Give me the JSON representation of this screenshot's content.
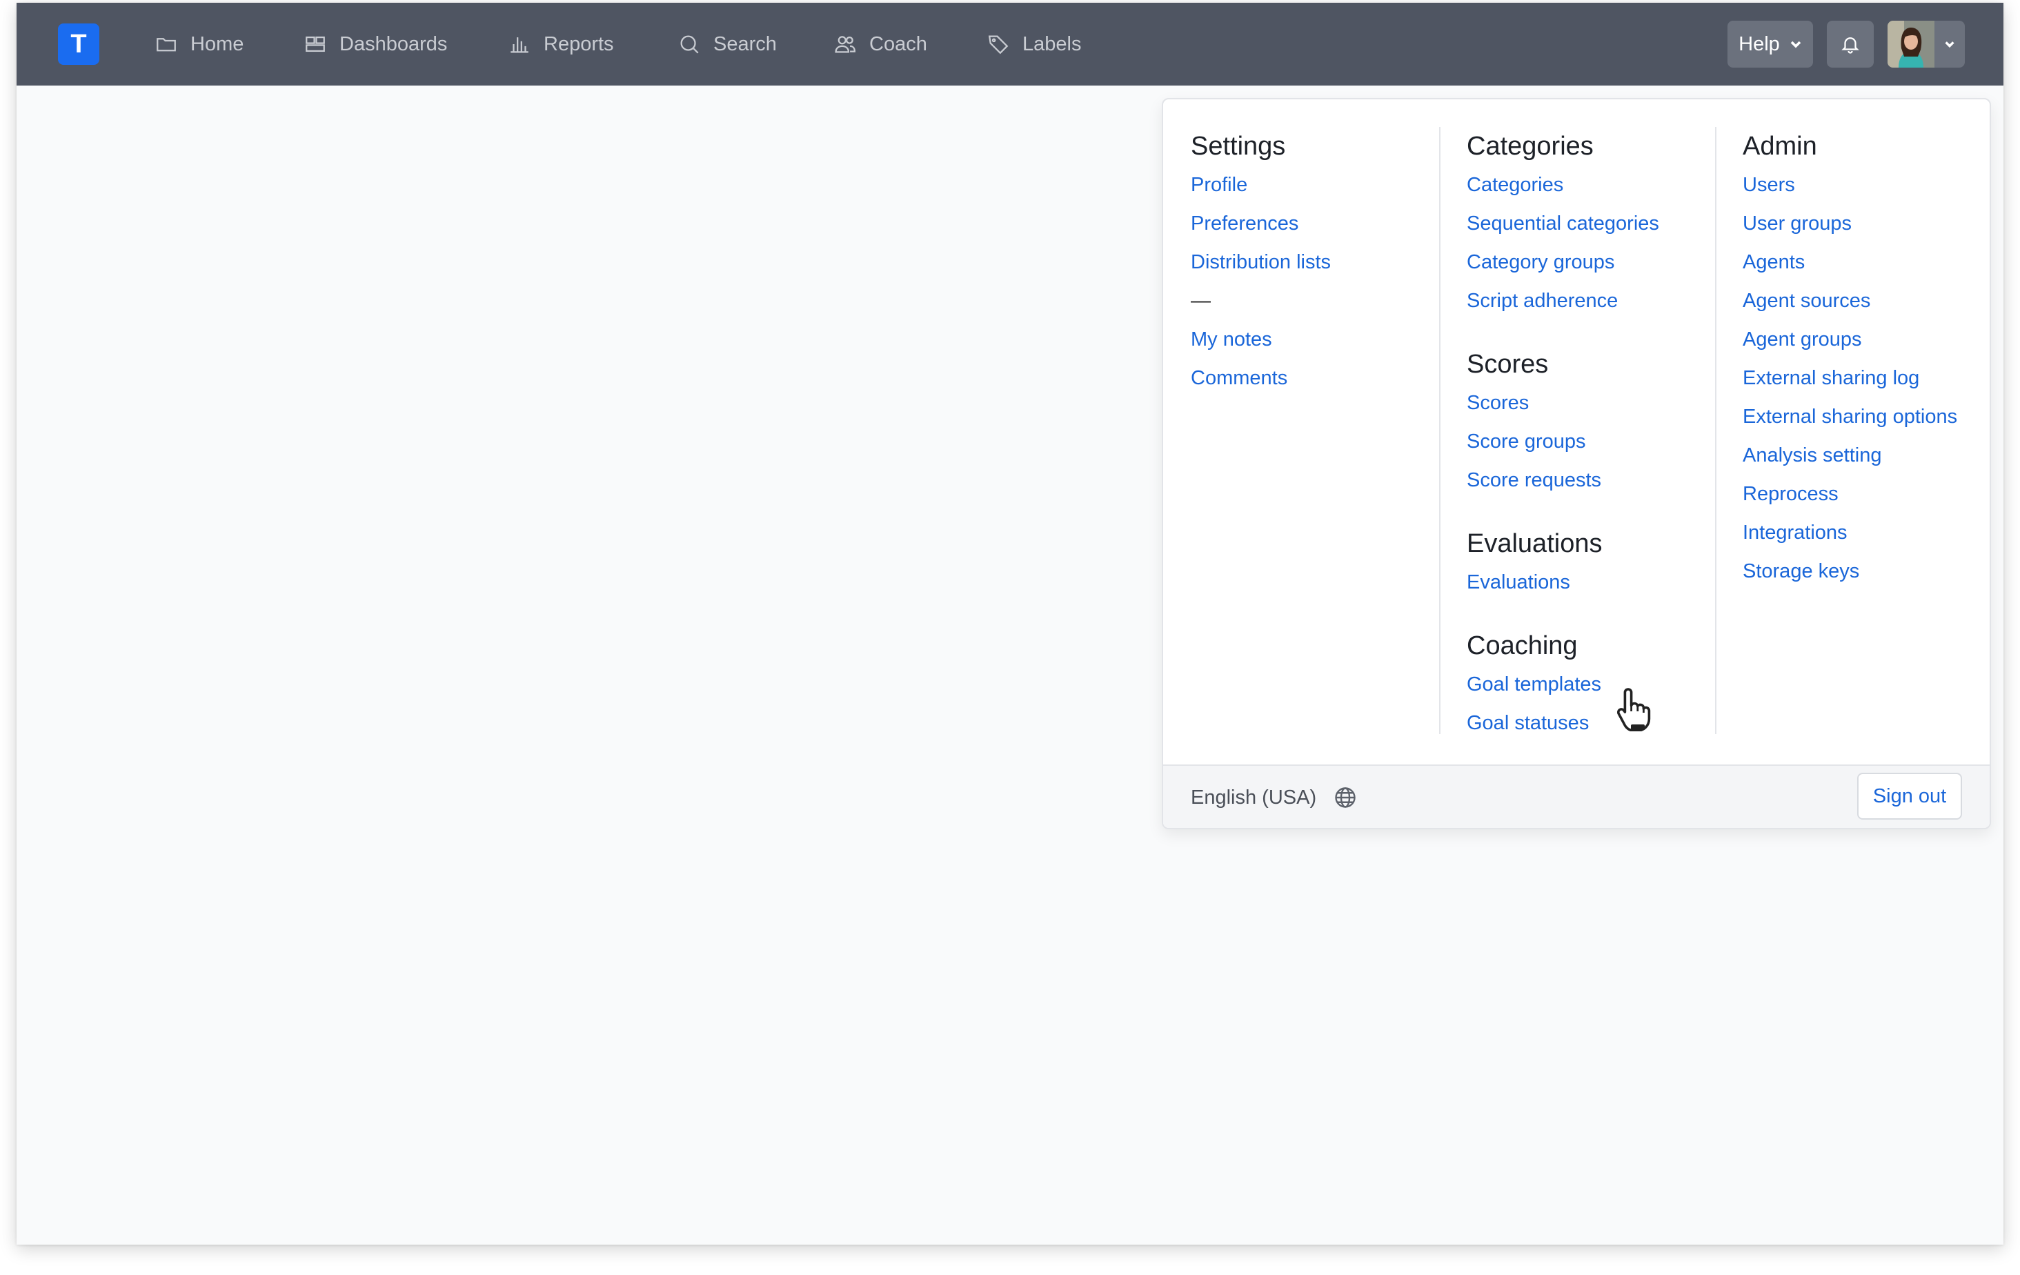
{
  "brand": {
    "logo_letter": "T",
    "color": "#1a6cf0"
  },
  "nav": {
    "items": [
      {
        "label": "Home",
        "icon": "folder-icon"
      },
      {
        "label": "Dashboards",
        "icon": "dashboard-icon"
      },
      {
        "label": "Reports",
        "icon": "bar-chart-icon"
      },
      {
        "label": "Search",
        "icon": "search-icon"
      },
      {
        "label": "Coach",
        "icon": "users-icon"
      },
      {
        "label": "Labels",
        "icon": "tag-icon"
      }
    ],
    "help_label": "Help"
  },
  "menu": {
    "settings": {
      "title": "Settings",
      "links": [
        "Profile",
        "Preferences",
        "Distribution lists"
      ],
      "separator": "—",
      "links2": [
        "My notes",
        "Comments"
      ]
    },
    "categories": {
      "title": "Categories",
      "links": [
        "Categories",
        "Sequential categories",
        "Category groups",
        "Script adherence"
      ]
    },
    "scores": {
      "title": "Scores",
      "links": [
        "Scores",
        "Score groups",
        "Score requests"
      ]
    },
    "evaluations": {
      "title": "Evaluations",
      "links": [
        "Evaluations"
      ]
    },
    "coaching": {
      "title": "Coaching",
      "links": [
        "Goal templates",
        "Goal statuses"
      ]
    },
    "admin": {
      "title": "Admin",
      "links": [
        "Users",
        "User groups",
        "Agents",
        "Agent sources",
        "Agent groups",
        "External sharing log",
        "External sharing options",
        "Analysis setting",
        "Reprocess",
        "Integrations",
        "Storage keys"
      ]
    },
    "footer": {
      "language": "English (USA)",
      "sign_out": "Sign out"
    }
  }
}
